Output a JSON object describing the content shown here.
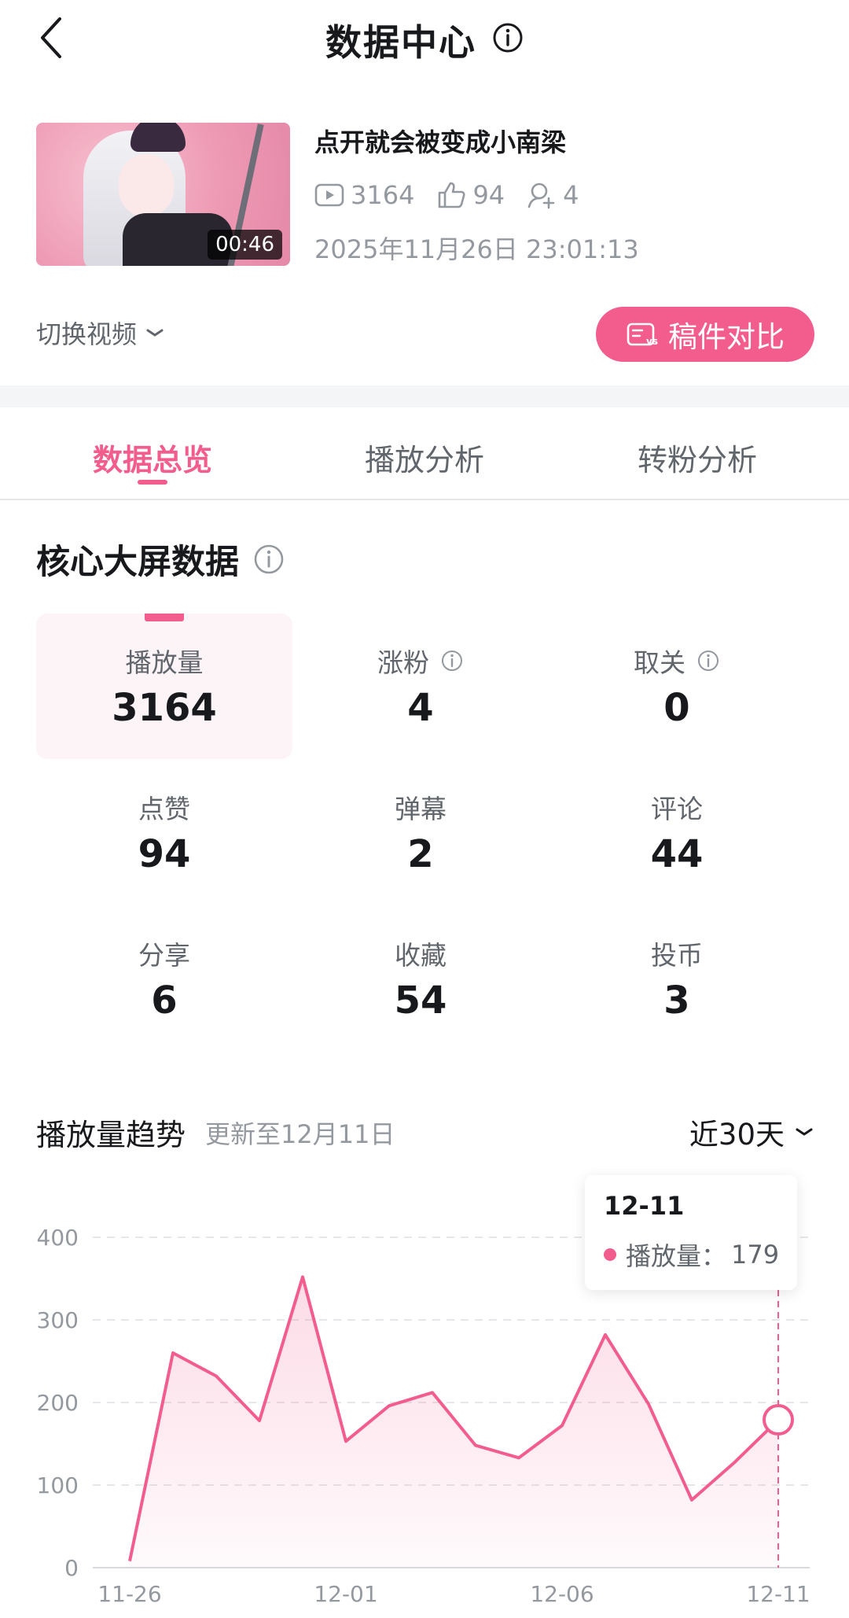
{
  "header": {
    "title": "数据中心"
  },
  "video": {
    "title": "点开就会被变成小南梁",
    "duration": "00:46",
    "plays": "3164",
    "likes": "94",
    "fans": "4",
    "publish_time": "2025年11月26日 23:01:13"
  },
  "actions": {
    "switch_video": "切换视频",
    "compare": "稿件对比"
  },
  "tabs": [
    {
      "label": "数据总览",
      "active": true
    },
    {
      "label": "播放分析",
      "active": false
    },
    {
      "label": "转粉分析",
      "active": false
    }
  ],
  "core": {
    "title": "核心大屏数据",
    "metrics": [
      {
        "label": "播放量",
        "value": "3164"
      },
      {
        "label": "涨粉",
        "value": "4"
      },
      {
        "label": "取关",
        "value": "0"
      },
      {
        "label": "点赞",
        "value": "94"
      },
      {
        "label": "弹幕",
        "value": "2"
      },
      {
        "label": "评论",
        "value": "44"
      },
      {
        "label": "分享",
        "value": "6"
      },
      {
        "label": "收藏",
        "value": "54"
      },
      {
        "label": "投币",
        "value": "3"
      }
    ]
  },
  "trend": {
    "title": "播放量趋势",
    "updated": "更新至12月11日",
    "range": "近30天"
  },
  "tooltip": {
    "date": "12-11",
    "label": "播放量：",
    "value": "179"
  },
  "colors": {
    "accent": "#f25d8e",
    "text_secondary": "#61666d",
    "text_muted": "#9499a0"
  },
  "chart_data": {
    "type": "area",
    "x": [
      "11-26",
      "11-27",
      "11-28",
      "11-29",
      "11-30",
      "12-01",
      "12-02",
      "12-03",
      "12-04",
      "12-05",
      "12-06",
      "12-07",
      "12-08",
      "12-09",
      "12-10",
      "12-11"
    ],
    "series": [
      {
        "name": "播放量",
        "values": [
          8,
          260,
          232,
          178,
          352,
          153,
          196,
          212,
          148,
          133,
          172,
          282,
          198,
          82,
          128,
          179
        ]
      }
    ],
    "ylim": [
      0,
      400
    ],
    "yticks": [
      0,
      100,
      200,
      300,
      400
    ],
    "xticks": [
      "11-26",
      "12-01",
      "12-06",
      "12-11"
    ],
    "grid": true,
    "highlight": "12-11"
  }
}
